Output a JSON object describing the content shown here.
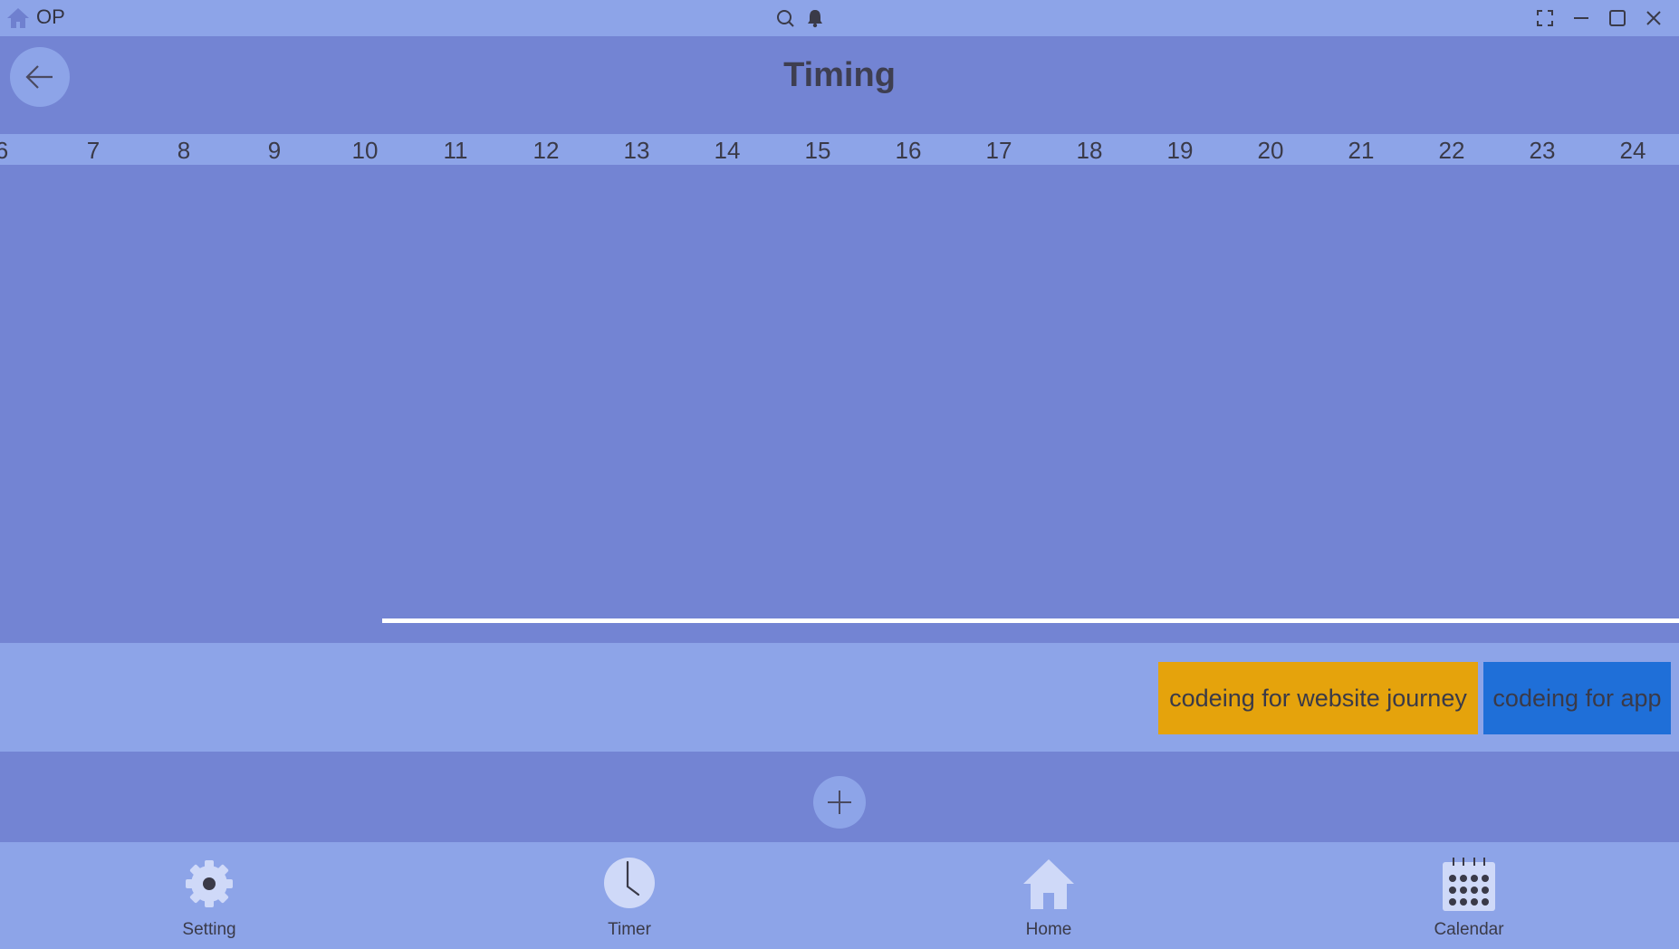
{
  "window": {
    "app_name": "OP",
    "icons": [
      "home-icon",
      "search-icon",
      "bell-icon",
      "fullscreen-icon",
      "minimize-icon",
      "maximize-icon",
      "close-icon"
    ]
  },
  "header": {
    "title": "Timing",
    "back_icon": "arrow-left-icon"
  },
  "ruler": {
    "hours": [
      "6",
      "7",
      "8",
      "9",
      "10",
      "11",
      "12",
      "13",
      "14",
      "15",
      "16",
      "17",
      "18",
      "19",
      "20",
      "21",
      "22",
      "23",
      "24"
    ]
  },
  "tasks": [
    {
      "label": "codeing for website journey",
      "color": "#e5a30c"
    },
    {
      "label": "codeing for app",
      "color": "#1f6fd8"
    }
  ],
  "add_button": {
    "icon": "plus-icon"
  },
  "nav": {
    "items": [
      {
        "label": "Setting",
        "icon": "gear-icon"
      },
      {
        "label": "Timer",
        "icon": "clock-icon"
      },
      {
        "label": "Home",
        "icon": "home-icon"
      },
      {
        "label": "Calendar",
        "icon": "calendar-icon"
      }
    ]
  },
  "colors": {
    "background": "#7384d3",
    "bar": "#8da4e8",
    "now_line": "#ffffff"
  }
}
